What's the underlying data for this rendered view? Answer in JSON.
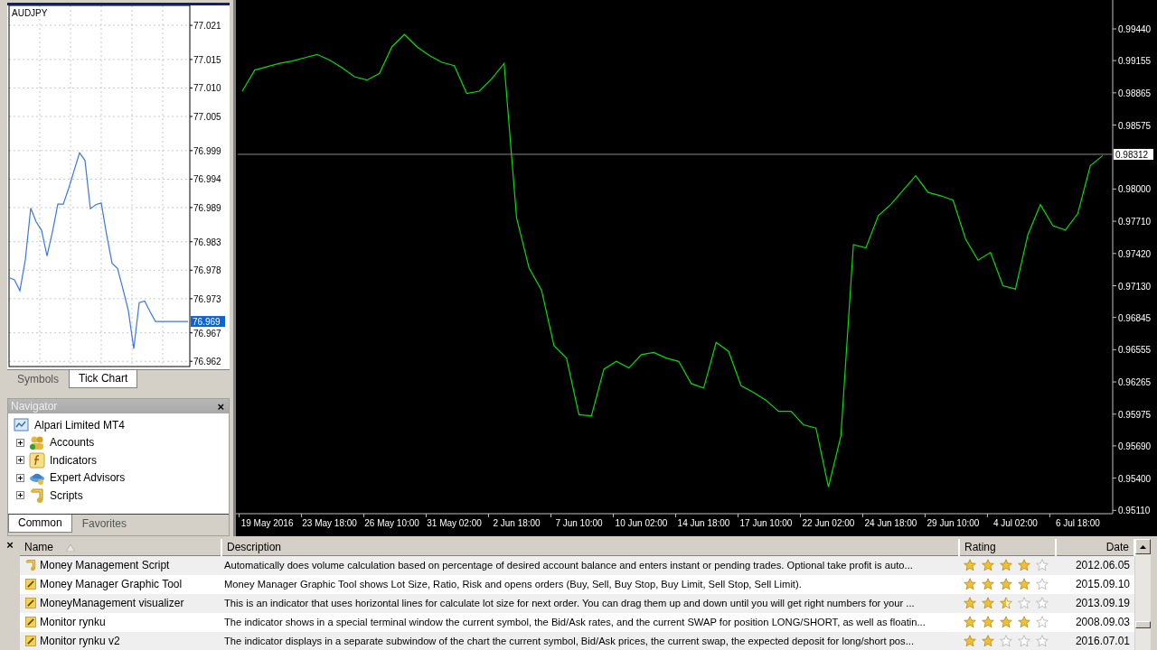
{
  "market_watch": {
    "chart_data": {
      "type": "line",
      "title": "AUDJPY",
      "categories": [
        null,
        null,
        null,
        null,
        null,
        null,
        null,
        null,
        null,
        null,
        null,
        null,
        null,
        null,
        null,
        null,
        null,
        null,
        null,
        null,
        null,
        null,
        null,
        null,
        null,
        null,
        null,
        null,
        null,
        null,
        null,
        null,
        null,
        null
      ],
      "series": [
        {
          "color": "#3a78e0",
          "values": [
            76.9767,
            76.9763,
            76.9744,
            76.9798,
            76.9889,
            76.9865,
            76.985,
            76.9805,
            76.9847,
            76.9896,
            76.9896,
            76.9924,
            76.9955,
            76.9986,
            76.9973,
            76.9888,
            76.9895,
            76.9898,
            76.9842,
            76.9792,
            76.9783,
            76.9747,
            76.9709,
            76.9642,
            76.9723,
            76.9726,
            76.9707,
            76.969,
            76.969,
            76.969,
            76.969,
            76.969,
            76.969,
            76.969
          ]
        }
      ],
      "ylim": [
        76.9614,
        77.0245
      ],
      "grid": true,
      "yticks": [
        {
          "value": 77.021,
          "label": "77.021"
        },
        {
          "value": 77.015,
          "label": "77.015"
        },
        {
          "value": 77.01,
          "label": "77.010"
        },
        {
          "value": 77.005,
          "label": "77.005"
        },
        {
          "value": 76.999,
          "label": "76.999"
        },
        {
          "value": 76.994,
          "label": "76.994"
        },
        {
          "value": 76.989,
          "label": "76.989"
        },
        {
          "value": 76.983,
          "label": "76.983"
        },
        {
          "value": 76.978,
          "label": "76.978"
        },
        {
          "value": 76.973,
          "label": "76.973"
        },
        {
          "value": 76.967,
          "label": "76.967"
        },
        {
          "value": 76.962,
          "label": "76.962"
        }
      ]
    },
    "bid_label": "76.969",
    "tabs": [
      {
        "label": "Symbols",
        "selected": false
      },
      {
        "label": "Tick Chart",
        "selected": true
      }
    ]
  },
  "navigator": {
    "title": "Navigator",
    "close": "×",
    "tree": [
      {
        "label": "Alpari Limited MT4",
        "kind": "terminal",
        "children": [
          {
            "label": "Accounts",
            "kind": "accounts",
            "expanded": false
          },
          {
            "label": "Indicators",
            "kind": "indicator",
            "expanded": false
          },
          {
            "label": "Expert Advisors",
            "kind": "expert",
            "expanded": false
          },
          {
            "label": "Scripts",
            "kind": "script",
            "expanded": false
          }
        ]
      }
    ],
    "tabs": [
      {
        "label": "Common",
        "selected": true
      },
      {
        "label": "Favorites",
        "selected": false
      }
    ]
  },
  "chart": {
    "chart_data": {
      "type": "line",
      "categories": [
        null,
        null,
        "19 May 2016",
        null,
        null,
        null,
        null,
        "23 May 18:00",
        null,
        null,
        null,
        null,
        "26 May 10:00",
        null,
        null,
        null,
        null,
        "31 May 02:00",
        null,
        null,
        null,
        null,
        "2 Jun 18:00",
        null,
        null,
        null,
        null,
        "7 Jun 10:00",
        null,
        null,
        null,
        null,
        "10 Jun 02:00",
        null,
        null,
        null,
        null,
        "14 Jun 18:00",
        null,
        null,
        null,
        null,
        "17 Jun 10:00",
        null,
        null,
        null,
        null,
        "22 Jun 02:00",
        null,
        null,
        null,
        null,
        "24 Jun 18:00",
        null,
        null,
        null,
        null,
        "29 Jun 10:00",
        null,
        null,
        null,
        null,
        "4 Jul 02:00",
        null,
        null,
        null,
        null,
        "6 Jul 18:00",
        null,
        null
      ],
      "series": [
        {
          "color": "#00e000",
          "values": [
            0.9888,
            0.9907,
            0.991,
            0.9913,
            0.9915,
            0.9918,
            0.9921,
            0.9916,
            0.9909,
            0.9901,
            0.9898,
            0.9904,
            0.9928,
            0.9939,
            0.9928,
            0.992,
            0.9914,
            0.9911,
            0.9886,
            0.9888,
            0.9899,
            0.9913,
            0.9774,
            0.9729,
            0.9709,
            0.9659,
            0.9648,
            0.9597,
            0.9596,
            0.9638,
            0.9645,
            0.9639,
            0.9651,
            0.9653,
            0.9648,
            0.9645,
            0.9625,
            0.9621,
            0.9662,
            0.9654,
            0.9623,
            0.9617,
            0.961,
            0.96,
            0.96,
            0.9588,
            0.9585,
            0.9532,
            0.9578,
            0.975,
            0.9747,
            0.9776,
            0.9786,
            0.9799,
            0.9812,
            0.9797,
            0.9794,
            0.979,
            0.9755,
            0.9736,
            0.9743,
            0.9713,
            0.971,
            0.9759,
            0.9786,
            0.9767,
            0.9763,
            0.9778,
            0.9821,
            0.983
          ]
        }
      ],
      "ylim": [
        0.95088,
        0.997
      ],
      "yticks": [
        {
          "value": 0.9944,
          "label": "0.99440"
        },
        {
          "value": 0.99155,
          "label": "0.99155"
        },
        {
          "value": 0.98865,
          "label": "0.98865"
        },
        {
          "value": 0.98575,
          "label": "0.98575"
        },
        {
          "value": 0.98,
          "label": "0.98000"
        },
        {
          "value": 0.9771,
          "label": "0.97710"
        },
        {
          "value": 0.9742,
          "label": "0.97420"
        },
        {
          "value": 0.9713,
          "label": "0.97130"
        },
        {
          "value": 0.96845,
          "label": "0.96845"
        },
        {
          "value": 0.96555,
          "label": "0.96555"
        },
        {
          "value": 0.96265,
          "label": "0.96265"
        },
        {
          "value": 0.95975,
          "label": "0.95975"
        },
        {
          "value": 0.9569,
          "label": "0.95690"
        },
        {
          "value": 0.954,
          "label": "0.95400"
        },
        {
          "value": 0.9511,
          "label": "0.95110"
        }
      ],
      "ref_lines": [
        {
          "axis": "y",
          "value": 0.98312,
          "label": "0.98312"
        }
      ]
    }
  },
  "library": {
    "close": "×",
    "columns": [
      {
        "label": "Name",
        "sorted": true
      },
      {
        "label": "Description",
        "sorted": false
      },
      {
        "label": "Rating",
        "sorted": false
      },
      {
        "label": "Date",
        "sorted": false
      }
    ],
    "rows": [
      {
        "kind": "script",
        "name": "Money Management Script",
        "description": "Automatically does volume calculation based on percentage of desired account balance and enters instant or pending trades. Optional take profit is auto...",
        "stars": 4,
        "date": "2012.06.05"
      },
      {
        "kind": "indicator",
        "name": "Money Manager Graphic Tool",
        "description": "Money Manager Graphic Tool shows Lot Size, Ratio, Risk and opens orders (Buy, Sell, Buy Stop, Buy Limit, Sell Stop, Sell Limit).",
        "stars": 4,
        "date": "2015.09.10"
      },
      {
        "kind": "indicator",
        "name": "MoneyManagement visualizer",
        "description": "This is an indicator that uses horizontal lines for calculate lot size for next order. You can drag them up and down until you will get right numbers for your ...",
        "stars": 2.5,
        "date": "2013.09.19"
      },
      {
        "kind": "indicator",
        "name": "Monitor rynku",
        "description": "The indicator shows in a special terminal window the current symbol, the Bid/Ask rates, and the current SWAP for position LONG/SHORT, as well as floatin...",
        "stars": 4,
        "date": "2008.09.03"
      },
      {
        "kind": "indicator",
        "name": "Monitor rynku v2",
        "description": "The indicator displays in a separate subwindow of the chart the current symbol, Bid/Ask prices, the current swap, the expected deposit for long/short pos...",
        "stars": 2,
        "date": "2016.07.01"
      }
    ]
  }
}
